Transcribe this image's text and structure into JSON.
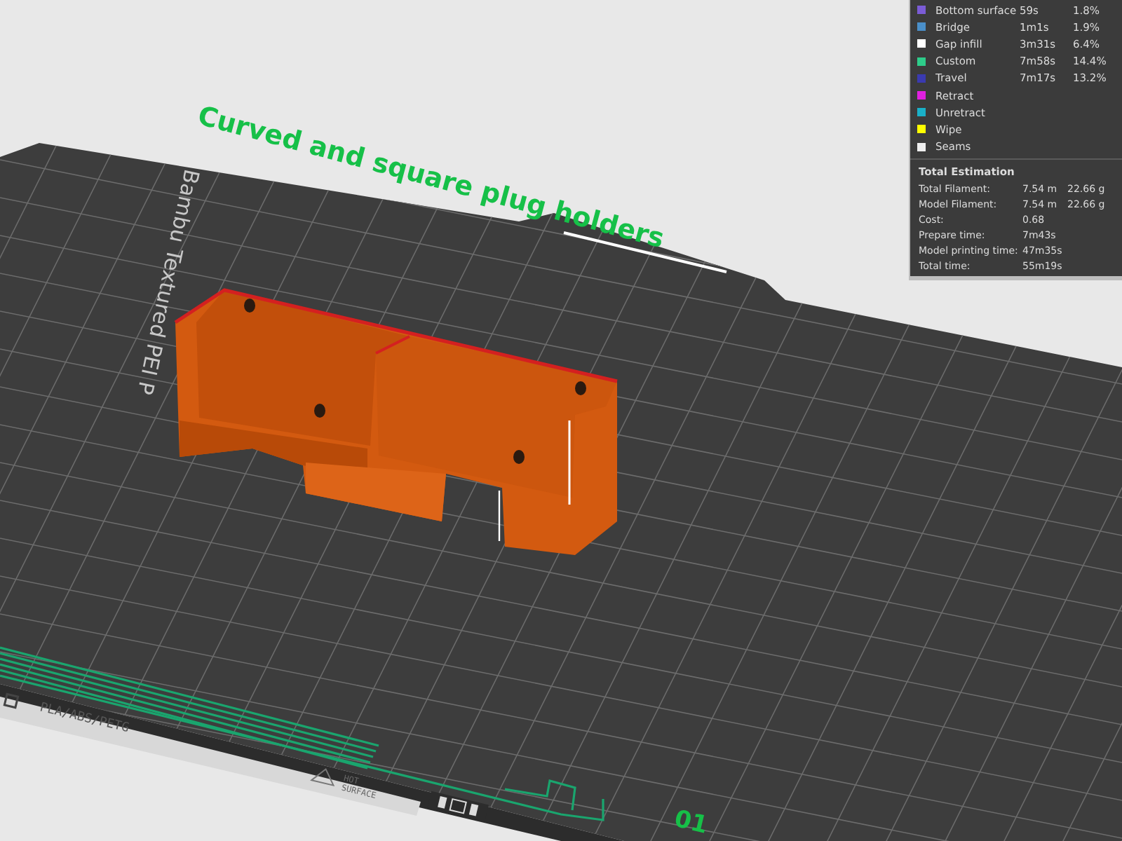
{
  "plate": {
    "title": "Curved and square plug holders",
    "brand_text": "Bambu Textured PEI P",
    "material_text": "PLA/ABS/PETG",
    "warning_lines": [
      "HOT",
      "SURFACE"
    ],
    "plate_number": "01"
  },
  "legend": {
    "items": [
      {
        "name": "Bottom surface",
        "time": "59s",
        "percent": "1.8%",
        "color": "#7b5cd6"
      },
      {
        "name": "Bridge",
        "time": "1m1s",
        "percent": "1.9%",
        "color": "#4a8fc9"
      },
      {
        "name": "Gap infill",
        "time": "3m31s",
        "percent": "6.4%",
        "color": "#ffffff"
      },
      {
        "name": "Custom",
        "time": "7m58s",
        "percent": "14.4%",
        "color": "#2ecc8a"
      },
      {
        "name": "Travel",
        "time": "7m17s",
        "percent": "13.2%",
        "color": "#3a3ab0"
      },
      {
        "name": "Retract",
        "color": "#e020e0"
      },
      {
        "name": "Unretract",
        "color": "#1ab0c8"
      },
      {
        "name": "Wipe",
        "color": "#ffff00"
      },
      {
        "name": "Seams",
        "color": "#eeeeee"
      }
    ]
  },
  "total_estimation": {
    "title": "Total Estimation",
    "rows": [
      {
        "label": "Total Filament:",
        "value": "7.54 m",
        "value_2": "22.66 g"
      },
      {
        "label": "Model Filament:",
        "value": "7.54 m",
        "value_2": "22.66 g"
      },
      {
        "label": "Cost:",
        "value": "0.68"
      },
      {
        "label": "Prepare time:",
        "value": "7m43s"
      },
      {
        "label": "Model printing time:",
        "value": "47m35s"
      },
      {
        "label": "Total time:",
        "value": "55m19s"
      }
    ]
  }
}
